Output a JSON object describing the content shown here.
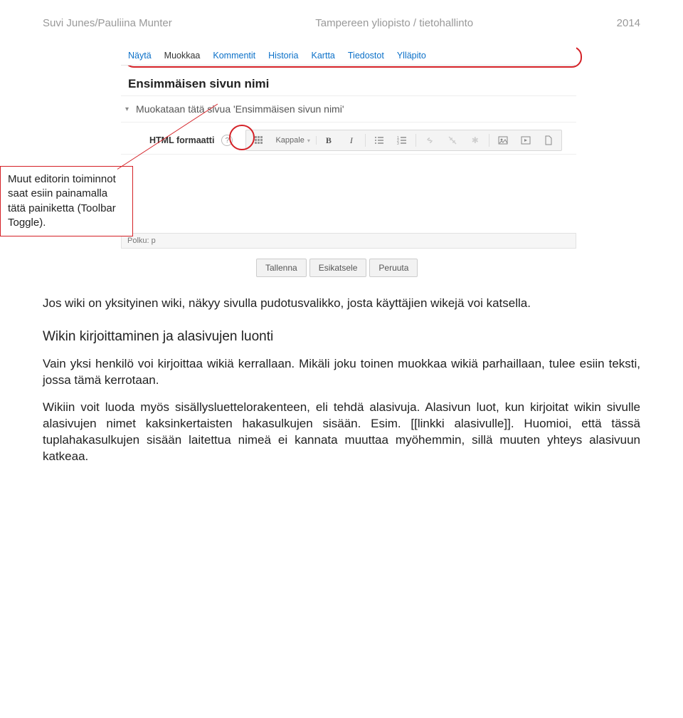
{
  "header": {
    "left": "Suvi Junes/Pauliina Munter",
    "mid": "Tampereen yliopisto / tietohallinto",
    "right": "2014"
  },
  "editor": {
    "tabs": [
      "Näytä",
      "Muokkaa",
      "Kommentit",
      "Historia",
      "Kartta",
      "Tiedostot",
      "Ylläpito"
    ],
    "active_tab_index": 1,
    "page_title": "Ensimmäisen sivun nimi",
    "section_title": "Muokataan tätä sivua 'Ensimmäisen sivun nimi'",
    "format_label": "HTML formaatti",
    "paragraph_style": "Kappale",
    "path_label": "Polku: p",
    "buttons": {
      "save": "Tallenna",
      "preview": "Esikatsele",
      "cancel": "Peruuta"
    }
  },
  "callout": "Muut editorin toiminnot saat esiin painamalla tätä painiketta (Toolbar Toggle).",
  "body": {
    "p1": "Jos wiki on yksityinen wiki, näkyy sivulla pudotusvalikko, josta käyttäjien wikejä voi katsella.",
    "h3": "Wikin kirjoittaminen ja alasivujen luonti",
    "p2": "Vain yksi henkilö voi kirjoittaa wikiä kerrallaan. Mikäli joku toinen muokkaa wikiä parhaillaan, tulee esiin teksti, jossa tämä kerrotaan.",
    "p3": "Wikiin voit luoda myös sisällysluettelorakenteen, eli tehdä alasivuja. Alasivun luot, kun kirjoitat wikin sivulle  alasivujen nimet kaksinkertaisten hakasulkujen sisään. Esim.  [[linkki alasivulle]]. Huomioi, että tässä tuplahakasulkujen sisään laitettua nimeä ei kannata muuttaa myöhemmin, sillä muuten yhteys alasivuun katkeaa."
  }
}
